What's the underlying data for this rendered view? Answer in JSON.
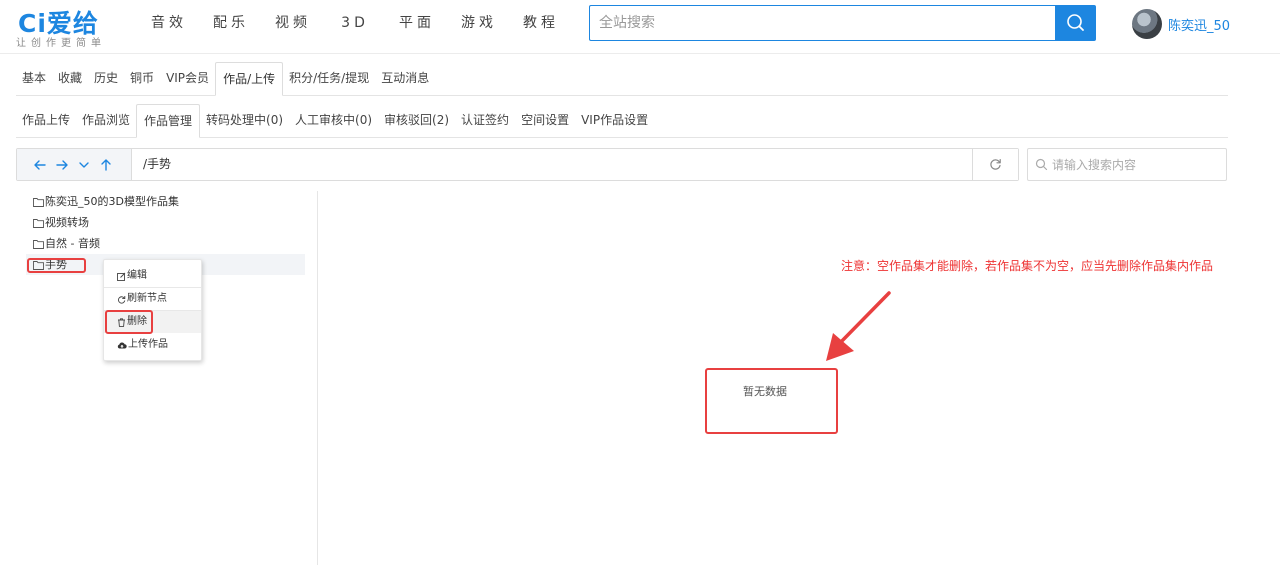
{
  "header": {
    "logo_text": "Ci爱给",
    "logo_slogan": "让创作更简单",
    "nav": [
      "音效",
      "配乐",
      "视频",
      "3D",
      "平面",
      "游戏",
      "教程"
    ],
    "search_placeholder": "全站搜索",
    "username": "陈奕迅_50"
  },
  "tabs_primary": [
    "基本",
    "收藏",
    "历史",
    "铜币",
    "VIP会员",
    "作品/上传",
    "积分/任务/提现",
    "互动消息"
  ],
  "tabs_secondary": [
    "作品上传",
    "作品浏览",
    "作品管理",
    "转码处理中(0)",
    "人工审核中(0)",
    "审核驳回(2)",
    "认证签约",
    "空间设置",
    "VIP作品设置"
  ],
  "pathbar": {
    "path": "/手势",
    "search_placeholder": "请输入搜索内容"
  },
  "tree": [
    "陈奕迅_50的3D模型作品集",
    "视频转场",
    "自然 - 音频",
    "手势"
  ],
  "context_menu": [
    "编辑",
    "刷新节点",
    "删除",
    "上传作品"
  ],
  "empty_text": "暂无数据",
  "note": "注意：空作品集才能删除，若作品集不为空，应当先删除作品集内作品",
  "colors": {
    "accent": "#1d86e0",
    "annotation": "#e84040"
  }
}
